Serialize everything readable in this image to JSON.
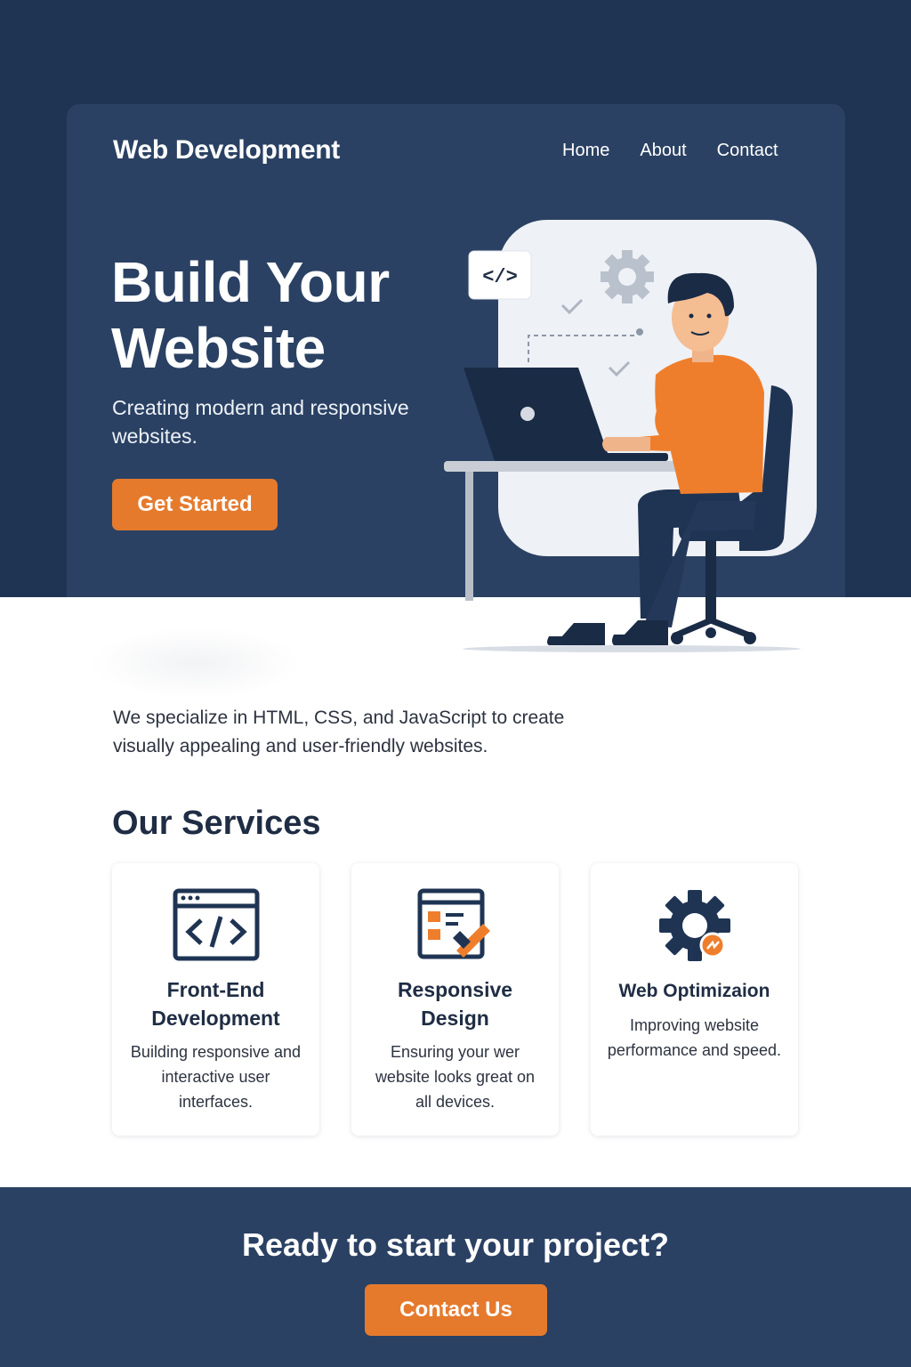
{
  "header": {
    "brand": "Web Development",
    "nav": [
      "Home",
      "About",
      "Contact"
    ]
  },
  "hero": {
    "title": "Build Your Website",
    "subtitle": "Creating modern and responsive websites.",
    "cta_label": "Get Started",
    "code_badge": "</>"
  },
  "intro": {
    "text": "We specialize in HTML, CSS, and JavaScript to create visually appealing and user-friendly websites."
  },
  "services": {
    "title": "Our Services",
    "items": [
      {
        "title": "Front-End Development",
        "description": "Building responsive and interactive user interfaces.",
        "icon": "code-window-icon"
      },
      {
        "title": "Responsive Design",
        "description": "Ensuring your wer website looks great on all devices.",
        "icon": "design-tools-icon"
      },
      {
        "title": "Web Optimizaion",
        "description": "Improving website performance and speed.",
        "icon": "gear-icon"
      }
    ]
  },
  "footer_cta": {
    "title": "Ready to start your project?",
    "button_label": "Contact Us"
  },
  "colors": {
    "dark_navy": "#1f3453",
    "card_navy": "#2a4163",
    "accent_orange": "#e57a2d",
    "text_dark": "#1f2d44"
  }
}
